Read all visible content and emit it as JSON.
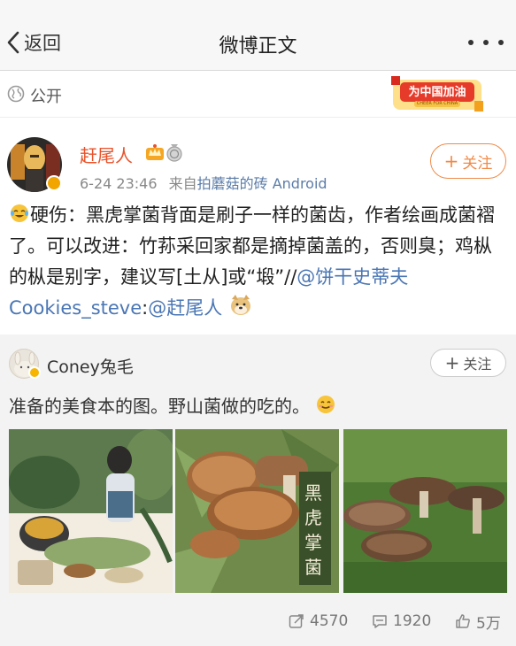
{
  "nav": {
    "back_label": "返回",
    "title": "微博正文"
  },
  "visibility": {
    "label": "公开",
    "badge_text": "为中国加油",
    "badge_subtext": "CHEER FOR CHINA"
  },
  "post": {
    "author": "赶尾人",
    "timestamp": "6-24 23:46",
    "source_prefix": "来自",
    "source_name": "拍蘑菇的砖 Android",
    "follow_label": "关注",
    "text_1": "硬伤：黑虎掌菌背面是刷子一样的菌齿，作者绘画成菌褶了。可以改进：竹荪采回家都是摘掉菌盖的，否则臭；鸡枞的枞是别字，建议写[土从]或“塅”//",
    "mention_1": "@饼干史蒂夫 Cookies_steve",
    "text_2": ":",
    "mention_2": "@赶尾人",
    "colors": {
      "author": "#e8532b",
      "link": "#4a76b4",
      "follow": "#f08a48"
    }
  },
  "repost": {
    "author": "Coney兔毛",
    "follow_label": "关注",
    "text": "准备的美食本的图。野山菌做的吃的。",
    "images": [
      {
        "icon": "illustration-girl-cooking"
      },
      {
        "icon": "illustration-mushrooms",
        "caption": "黑虎掌菌"
      },
      {
        "icon": "photo-mushrooms-grass"
      }
    ]
  },
  "actions": {
    "reposts": "4570",
    "comments": "1920",
    "likes": "5万"
  }
}
